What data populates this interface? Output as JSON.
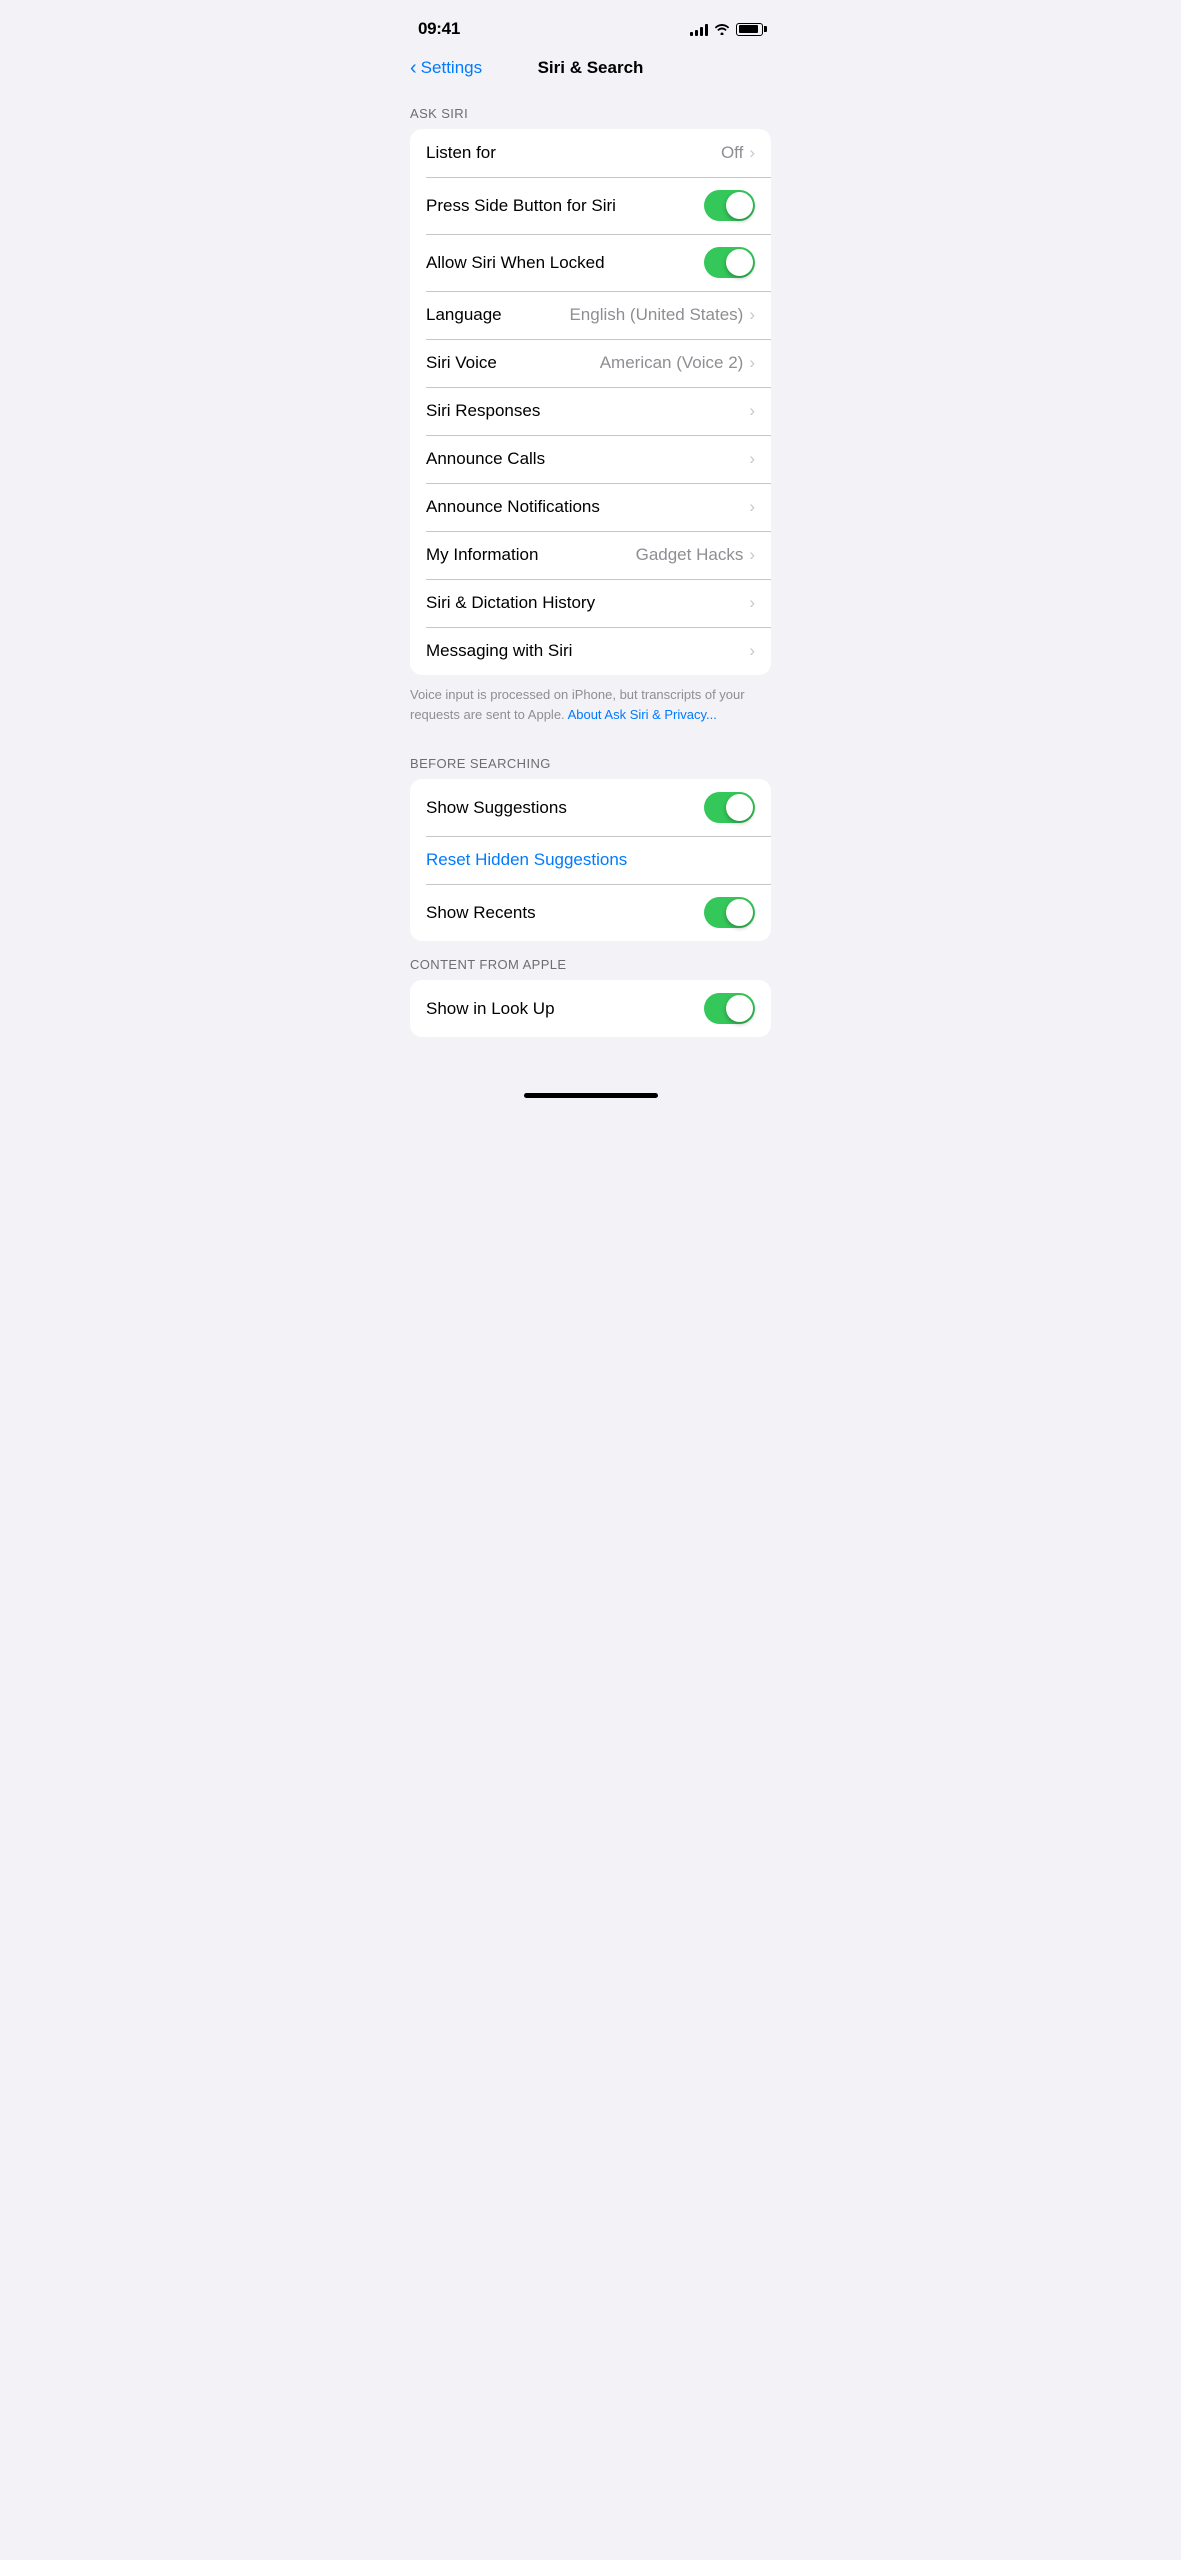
{
  "statusBar": {
    "time": "09:41",
    "icons": {
      "signal": "signal-icon",
      "wifi": "wifi-icon",
      "battery": "battery-icon"
    }
  },
  "navBar": {
    "backLabel": "Settings",
    "title": "Siri & Search"
  },
  "sections": {
    "askSiri": {
      "header": "ASK SIRI",
      "rows": [
        {
          "label": "Listen for",
          "value": "Off",
          "type": "chevron"
        },
        {
          "label": "Press Side Button for Siri",
          "value": "",
          "type": "toggle",
          "toggleOn": true
        },
        {
          "label": "Allow Siri When Locked",
          "value": "",
          "type": "toggle",
          "toggleOn": true
        },
        {
          "label": "Language",
          "value": "English (United States)",
          "type": "chevron"
        },
        {
          "label": "Siri Voice",
          "value": "American (Voice 2)",
          "type": "chevron"
        },
        {
          "label": "Siri Responses",
          "value": "",
          "type": "chevron"
        },
        {
          "label": "Announce Calls",
          "value": "",
          "type": "chevron"
        },
        {
          "label": "Announce Notifications",
          "value": "",
          "type": "chevron"
        },
        {
          "label": "My Information",
          "value": "Gadget Hacks",
          "type": "chevron"
        },
        {
          "label": "Siri & Dictation History",
          "value": "",
          "type": "chevron"
        },
        {
          "label": "Messaging with Siri",
          "value": "",
          "type": "chevron"
        }
      ],
      "footerText": "Voice input is processed on iPhone, but transcripts of your requests are sent to Apple. ",
      "footerLink": "About Ask Siri & Privacy...",
      "footerLinkHref": "#"
    },
    "beforeSearching": {
      "header": "BEFORE SEARCHING",
      "rows": [
        {
          "label": "Show Suggestions",
          "value": "",
          "type": "toggle",
          "toggleOn": true
        },
        {
          "label": "Reset Hidden Suggestions",
          "value": "",
          "type": "reset"
        },
        {
          "label": "Show Recents",
          "value": "",
          "type": "toggle",
          "toggleOn": true
        }
      ]
    },
    "contentFromApple": {
      "header": "CONTENT FROM APPLE",
      "rows": [
        {
          "label": "Show in Look Up",
          "value": "",
          "type": "toggle",
          "toggleOn": true
        }
      ]
    }
  }
}
